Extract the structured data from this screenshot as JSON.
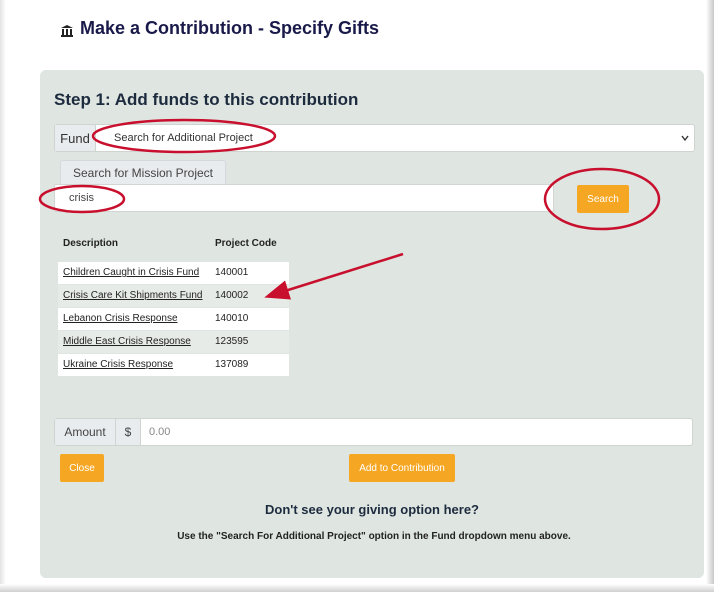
{
  "header": {
    "title": "Make a Contribution - Specify Gifts",
    "icon": "bank-icon"
  },
  "step": {
    "title": "Step 1: Add funds to this contribution"
  },
  "fund": {
    "label": "Fund",
    "selected": "Search for Additional Project"
  },
  "search": {
    "tab_label": "Search for Mission Project",
    "value": "crisis",
    "button_label": "Search"
  },
  "results": {
    "columns": [
      "Description",
      "Project Code"
    ],
    "rows": [
      {
        "description": "Children Caught in Crisis Fund",
        "code": "140001"
      },
      {
        "description": "Crisis Care Kit Shipments Fund",
        "code": "140002"
      },
      {
        "description": "Lebanon Crisis Response",
        "code": "140010"
      },
      {
        "description": "Middle East Crisis Response",
        "code": "123595"
      },
      {
        "description": "Ukraine Crisis Response",
        "code": "137089"
      }
    ]
  },
  "amount": {
    "label": "Amount",
    "currency": "$",
    "placeholder": "0.00"
  },
  "actions": {
    "close_label": "Close",
    "add_label": "Add to Contribution"
  },
  "help": {
    "title": "Don't see your giving option here?",
    "body": "Use the \"Search For Additional Project\" option in the Fund dropdown menu above."
  },
  "colors": {
    "accent": "#f5a623",
    "panel": "#dfe5e0",
    "annotation": "#c8102e",
    "title": "#1a1a4a"
  }
}
